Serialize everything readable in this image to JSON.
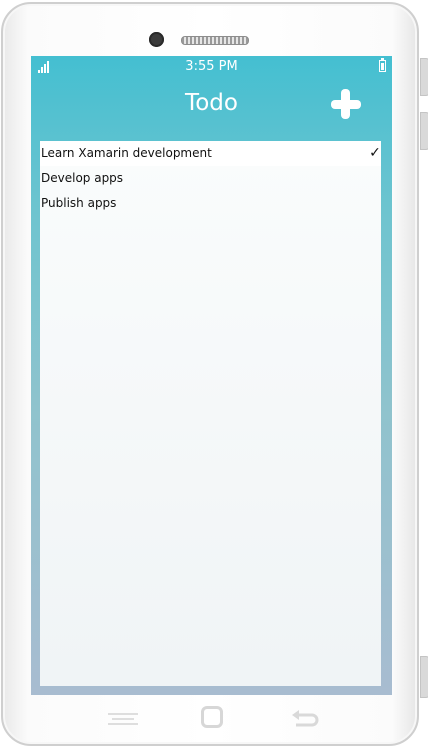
{
  "status_bar": {
    "time": "3:55 PM"
  },
  "nav": {
    "title": "Todo"
  },
  "todo_items": [
    {
      "label": "Learn Xamarin development",
      "done": true,
      "check": "✓"
    },
    {
      "label": "Develop apps",
      "done": false
    },
    {
      "label": "Publish apps",
      "done": false
    }
  ],
  "colors": {
    "header_teal": "#44bfd1",
    "gradient_bottom": "#a8bcd0",
    "list_background": "#f0f4f6",
    "text": "#111111"
  },
  "icons": {
    "signal": "signal-icon",
    "battery": "battery-icon",
    "add": "plus-icon",
    "check": "check-icon",
    "menu_key": "menu-icon",
    "home_key": "home-icon",
    "back_key": "back-arrow-icon"
  }
}
